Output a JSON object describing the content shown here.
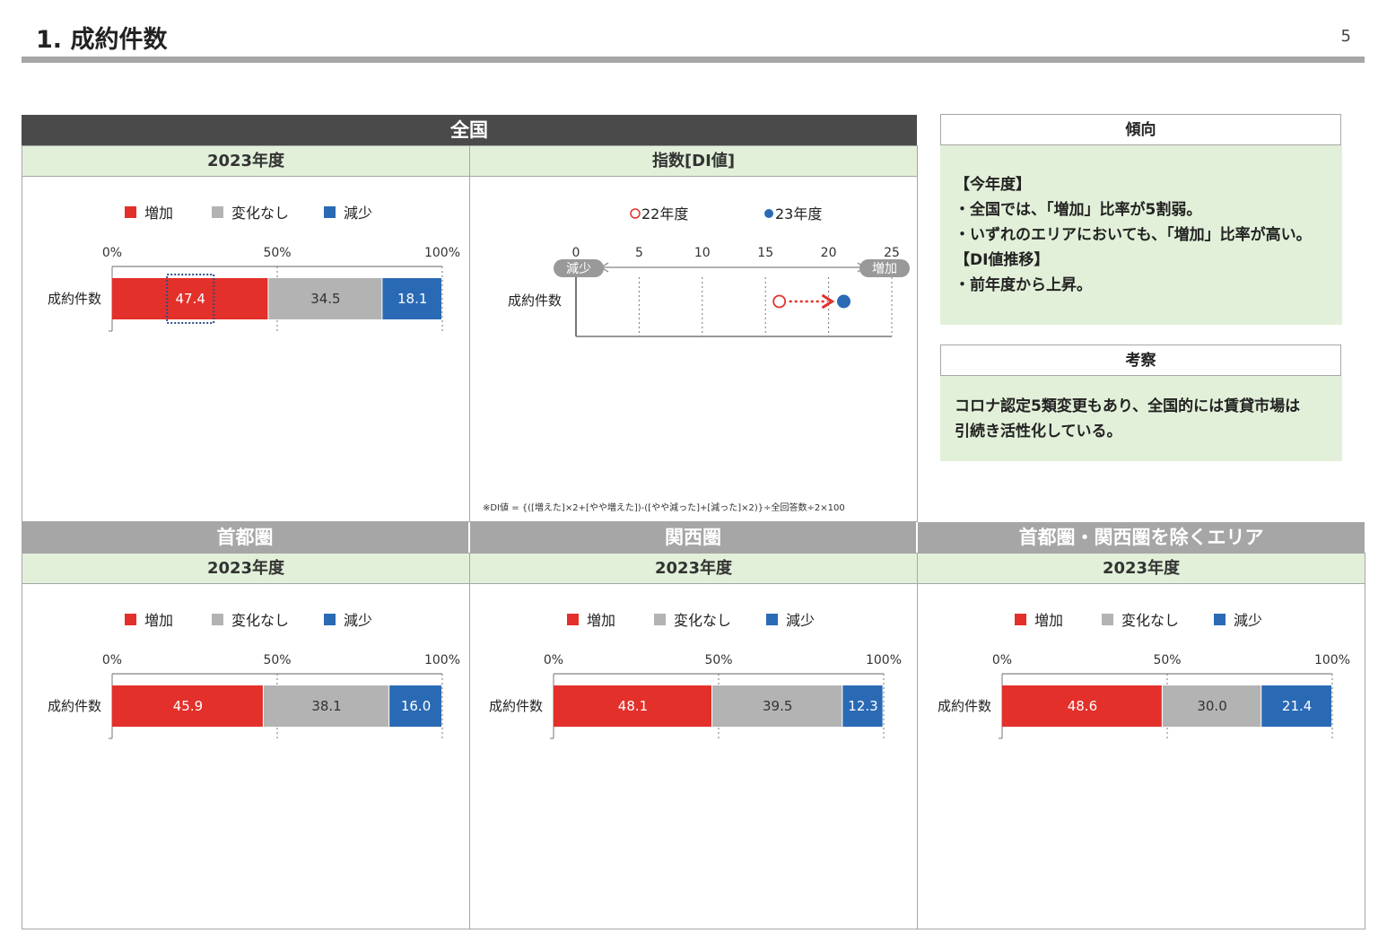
{
  "page": {
    "title": "1. 成約件数",
    "page_number": "5"
  },
  "national": {
    "band_title": "全国",
    "year_header": "2023年度",
    "di_header": "指数[DI値]",
    "di_note": "※DI値 = {([増えた]×2+[やや増えた])-([やや減った]+[減った]×2)}÷全回答数÷2×100"
  },
  "regions": [
    {
      "band_title": "首都圏",
      "year_header": "2023年度"
    },
    {
      "band_title": "関西圏",
      "year_header": "2023年度"
    },
    {
      "band_title": "首都圏・関西圏を除くエリア",
      "year_header": "2023年度"
    }
  ],
  "side": {
    "trend_title": "傾向",
    "trend_lines": [
      "【今年度】",
      "・全国では、「増加」比率が5割弱。",
      "・いずれのエリアにおいても、「増加」比率が高い。",
      "【DI値推移】",
      "・前年度から上昇。"
    ],
    "insight_title": "考察",
    "insight_lines": [
      "コロナ認定5類変更もあり、全国的には賃貸市場は",
      "引続き活性化している。"
    ]
  },
  "colors": {
    "increase": "#e3302a",
    "unchanged": "#b3b3b3",
    "decrease": "#2a6ab5",
    "band_dark": "#4a4a4a",
    "band_gray": "#a6a6a6",
    "sub_bg": "#e2f0d9"
  },
  "chart_data": [
    {
      "type": "bar",
      "stacked": true,
      "orientation": "horizontal",
      "panel": "national",
      "categories": [
        "成約件数"
      ],
      "xlim": [
        0,
        100
      ],
      "ticks": [
        "0%",
        "50%",
        "100%"
      ],
      "legend": "top",
      "series": [
        {
          "name": "増加",
          "values": [
            47.4
          ]
        },
        {
          "name": "変化なし",
          "values": [
            34.5
          ]
        },
        {
          "name": "減少",
          "values": [
            18.1
          ]
        }
      ],
      "highlight_series": "増加"
    },
    {
      "type": "scatter",
      "panel": "national-di",
      "categories": [
        "成約件数"
      ],
      "xlim": [
        0,
        25
      ],
      "ticks": [
        0,
        5,
        10,
        15,
        20,
        25
      ],
      "axis_end_labels": {
        "left": "減少",
        "right": "増加"
      },
      "legend": "top",
      "series": [
        {
          "name": "22年度",
          "values": [
            16.1
          ],
          "marker": "open-circle"
        },
        {
          "name": "23年度",
          "values": [
            21.2
          ],
          "marker": "filled-circle"
        }
      ]
    },
    {
      "type": "bar",
      "stacked": true,
      "orientation": "horizontal",
      "panel": "shutoken",
      "categories": [
        "成約件数"
      ],
      "xlim": [
        0,
        100
      ],
      "ticks": [
        "0%",
        "50%",
        "100%"
      ],
      "legend": "top",
      "series": [
        {
          "name": "増加",
          "values": [
            45.9
          ]
        },
        {
          "name": "変化なし",
          "values": [
            38.1
          ]
        },
        {
          "name": "減少",
          "values": [
            16.0
          ]
        }
      ]
    },
    {
      "type": "bar",
      "stacked": true,
      "orientation": "horizontal",
      "panel": "kansai",
      "categories": [
        "成約件数"
      ],
      "xlim": [
        0,
        100
      ],
      "ticks": [
        "0%",
        "50%",
        "100%"
      ],
      "legend": "top",
      "series": [
        {
          "name": "増加",
          "values": [
            48.1
          ]
        },
        {
          "name": "変化なし",
          "values": [
            39.5
          ]
        },
        {
          "name": "減少",
          "values": [
            12.3
          ]
        }
      ]
    },
    {
      "type": "bar",
      "stacked": true,
      "orientation": "horizontal",
      "panel": "other",
      "categories": [
        "成約件数"
      ],
      "xlim": [
        0,
        100
      ],
      "ticks": [
        "0%",
        "50%",
        "100%"
      ],
      "legend": "top",
      "series": [
        {
          "name": "増加",
          "values": [
            48.6
          ]
        },
        {
          "name": "変化なし",
          "values": [
            30.0
          ]
        },
        {
          "name": "減少",
          "values": [
            21.4
          ]
        }
      ]
    }
  ]
}
